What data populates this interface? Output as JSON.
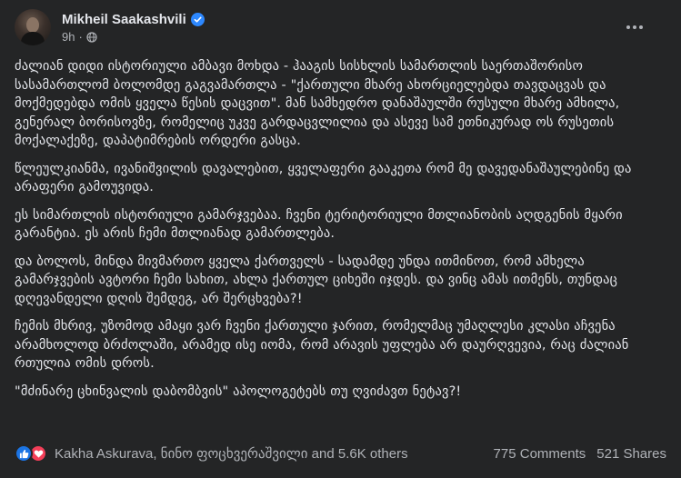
{
  "post": {
    "author": "Mikheil Saakashvili",
    "time": "9h",
    "paragraphs": [
      "ძალიან დიდი ისტორიული ამბავი მოხდა - ჰააგის სისხლის სამართლის საერთაშორისო სასამართლომ ბოლომდე გაგვამართლა - \"ქართული მხარე ახორციელებდა თავდაცვას და მოქმედებდა ომის ყველა წესის დაცვით\". მან სამხედრო დანაშაულში რუსული მხარე ამხილა, გენერალ ბორისოვზე, რომელიც უკვე გარდაცვლილია და ასევე სამ ეთნიკურად ოს რუსეთის მოქალაქეზე, დაპატიმრების ორდერი გასცა.",
      "წლეულკიანმა, ივანიშვილის დავალებით, ყველაფერი გააკეთა რომ მე დავედანაშაულებინე და არაფერი გამოუვიდა.",
      "ეს სიმართლის ისტორიული გამარჯვებაა. ჩვენი ტერიტორიული მთლიანობის აღდგენის მყარი გარანტია. ეს არის ჩემი მთლიანად გამართლება.",
      "და ბოლოს, მინდა მივმართო ყველა ქართველს - სადამდე უნდა ითმინოთ, რომ ამხელა გამარჯვების ავტორი ჩემი სახით, ახლა ქართულ ციხეში იჯდეს. და ვინც ამას ითმენს, თუნდაც დღევანდელი დღის შემდეგ, არ შერცხვება?!",
      "ჩემის მხრივ, უზომოდ ამაყი ვარ ჩვენი ქართული ჯარით, რომელმაც უმაღლესი კლასი აჩვენა არამხოლოდ ბრძოლაში, არამედ ისე იომა, რომ არავის უფლება არ დაურღვევია, რაც ძალიან რთულია ომის დროს.",
      "\"მძინარე ცხინვალის დაბომბვის\" აპოლოგეტებს თუ ღვიძავთ ნეტავ?!"
    ]
  },
  "footer": {
    "reacted_by": "Kakha Askurava, ნინო ფოცხვერაშვილი and 5.6K others",
    "comments": "775 Comments",
    "shares": "521 Shares"
  },
  "icons": {
    "verified": "verified-badge-icon",
    "audience": "globe-icon",
    "more": "more-options-icon",
    "like": "like-reaction-icon",
    "love": "love-reaction-icon"
  },
  "colors": {
    "background": "#242526",
    "text": "#e4e6eb",
    "secondary_text": "#b0b3b8",
    "verified_blue": "#2d88ff",
    "like_blue": "#1b74e4",
    "love_red": "#f33e58"
  }
}
